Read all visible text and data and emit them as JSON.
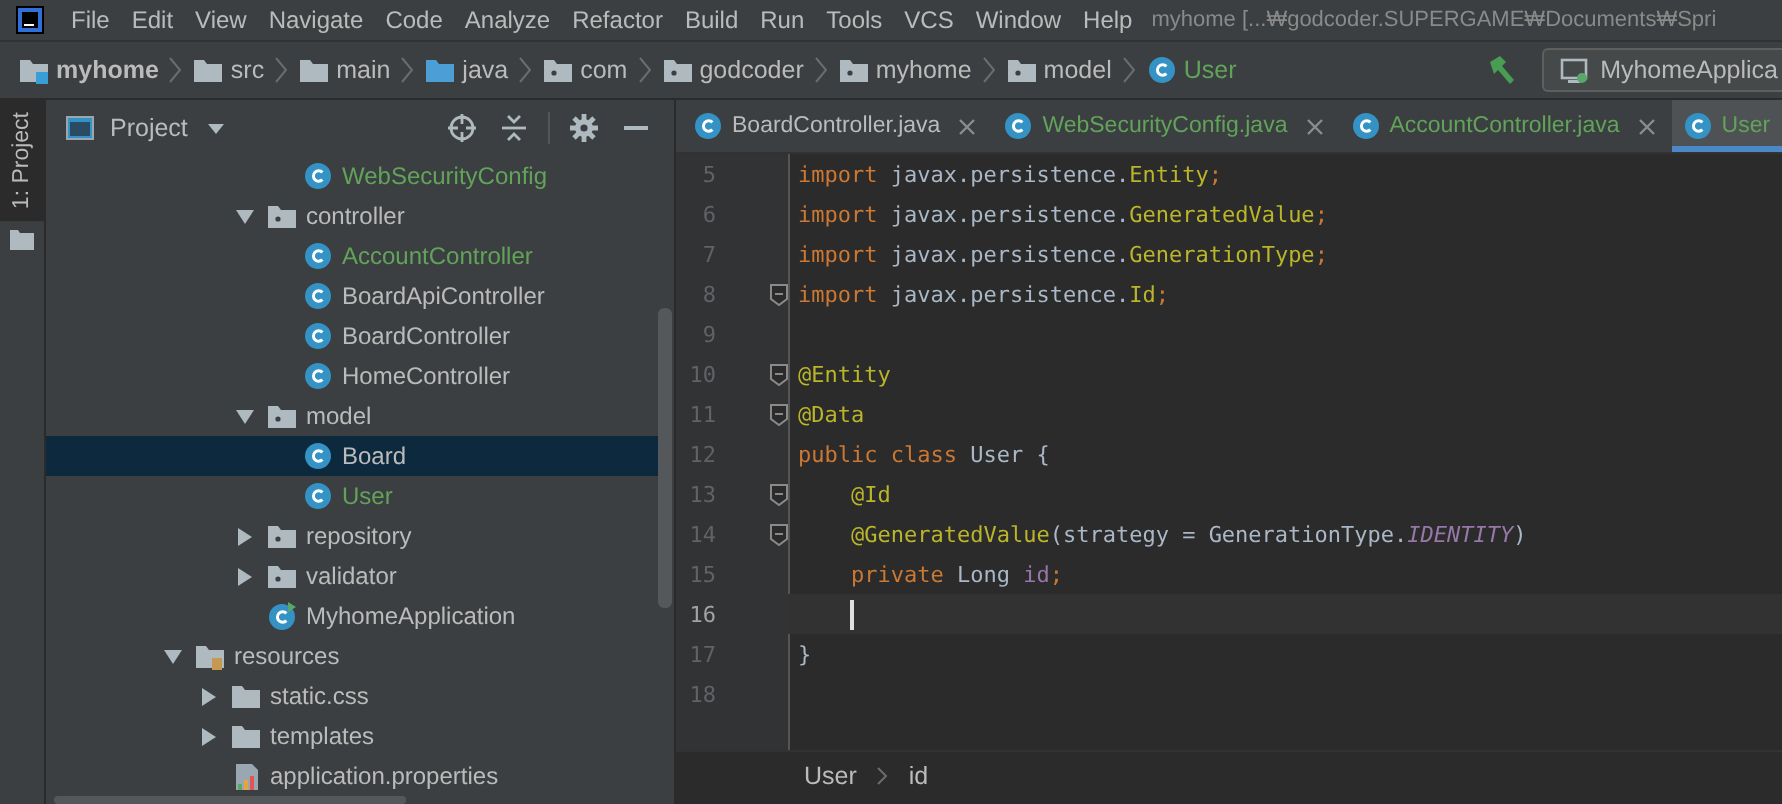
{
  "menu": [
    "File",
    "Edit",
    "View",
    "Navigate",
    "Code",
    "Analyze",
    "Refactor",
    "Build",
    "Run",
    "Tools",
    "VCS",
    "Window",
    "Help"
  ],
  "window": {
    "title": "myhome [...₩godcoder.SUPERGAME₩Documents₩Spri"
  },
  "breadcrumbs": [
    {
      "label": "myhome",
      "kind": "module",
      "color": "#bbbbbb"
    },
    {
      "label": "src",
      "kind": "folder",
      "color": "#bbbbbb"
    },
    {
      "label": "main",
      "kind": "folder",
      "color": "#bbbbbb"
    },
    {
      "label": "java",
      "kind": "source",
      "color": "#bbbbbb"
    },
    {
      "label": "com",
      "kind": "package",
      "color": "#bbbbbb"
    },
    {
      "label": "godcoder",
      "kind": "package",
      "color": "#bbbbbb"
    },
    {
      "label": "myhome",
      "kind": "package",
      "color": "#bbbbbb"
    },
    {
      "label": "model",
      "kind": "package",
      "color": "#bbbbbb"
    },
    {
      "label": "User",
      "kind": "class",
      "color": "#62a35a"
    }
  ],
  "run_config": {
    "label": "MyhomeApplica"
  },
  "side_tab": {
    "label": "1: Project"
  },
  "project_panel": {
    "title": "Project"
  },
  "tree": [
    {
      "children": [
        {
          "children": [
            {
              "children": [
                {
                  "label": "WebSecurityConfig",
                  "kind": "class",
                  "color": "#62a35a",
                  "selected": false
                }
              ]
            },
            {
              "label": "controller",
              "kind": "package",
              "expanded": true,
              "selected": false,
              "color": "#bbbbbb",
              "children": [
                {
                  "label": "AccountController",
                  "kind": "class",
                  "color": "#62a35a",
                  "selected": false
                },
                {
                  "label": "BoardApiController",
                  "kind": "class",
                  "color": "#bbbbbb",
                  "selected": false
                },
                {
                  "label": "BoardController",
                  "kind": "class",
                  "color": "#bbbbbb",
                  "selected": false
                },
                {
                  "label": "HomeController",
                  "kind": "class",
                  "color": "#bbbbbb",
                  "selected": false
                }
              ]
            },
            {
              "label": "model",
              "kind": "package",
              "expanded": true,
              "selected": false,
              "color": "#bbbbbb",
              "children": [
                {
                  "label": "Board",
                  "kind": "class",
                  "color": "#bbbbbb",
                  "selected": true
                },
                {
                  "label": "User",
                  "kind": "class",
                  "color": "#62a35a",
                  "selected": false
                }
              ]
            },
            {
              "label": "repository",
              "kind": "package",
              "expanded": false,
              "selected": false,
              "color": "#bbbbbb"
            },
            {
              "label": "validator",
              "kind": "package",
              "expanded": false,
              "selected": false,
              "color": "#bbbbbb"
            },
            {
              "label": "MyhomeApplication",
              "kind": "app",
              "color": "#bbbbbb",
              "selected": false
            }
          ]
        }
      ]
    },
    {
      "label": "resources",
      "kind": "resources",
      "expanded": true,
      "selected": false,
      "color": "#bbbbbb",
      "children": [
        {
          "label": "static.css",
          "kind": "folder",
          "expanded": false,
          "selected": false,
          "color": "#bbbbbb"
        },
        {
          "label": "templates",
          "kind": "folder",
          "expanded": false,
          "selected": false,
          "color": "#bbbbbb"
        },
        {
          "label": "application.properties",
          "kind": "properties",
          "color": "#bbbbbb",
          "selected": false
        }
      ]
    }
  ],
  "tabs": [
    {
      "label": "BoardController.java",
      "color": "#bbbbbb",
      "selected": false,
      "closable": true
    },
    {
      "label": "WebSecurityConfig.java",
      "color": "#62a35a",
      "selected": false,
      "closable": true
    },
    {
      "label": "AccountController.java",
      "color": "#62a35a",
      "selected": false,
      "closable": true
    },
    {
      "label": "User",
      "color": "#62a35a",
      "selected": true,
      "closable": false
    }
  ],
  "code": [
    {
      "number": "5",
      "fold": false,
      "current": false,
      "tokens": [
        {
          "text": "import",
          "kind": "keyword"
        },
        {
          "text": " javax.persistence.",
          "kind": "plain"
        },
        {
          "text": "Entity",
          "kind": "annotation"
        },
        {
          "text": ";",
          "kind": "keyword"
        }
      ]
    },
    {
      "number": "6",
      "fold": false,
      "current": false,
      "tokens": [
        {
          "text": "import",
          "kind": "keyword"
        },
        {
          "text": " javax.persistence.",
          "kind": "plain"
        },
        {
          "text": "GeneratedValue",
          "kind": "annotation"
        },
        {
          "text": ";",
          "kind": "keyword"
        }
      ]
    },
    {
      "number": "7",
      "fold": false,
      "current": false,
      "tokens": [
        {
          "text": "import",
          "kind": "keyword"
        },
        {
          "text": " javax.persistence.",
          "kind": "plain"
        },
        {
          "text": "GenerationType",
          "kind": "annotation"
        },
        {
          "text": ";",
          "kind": "keyword"
        }
      ]
    },
    {
      "number": "8",
      "fold": true,
      "current": false,
      "tokens": [
        {
          "text": "import",
          "kind": "keyword"
        },
        {
          "text": " javax.persistence.",
          "kind": "plain"
        },
        {
          "text": "Id",
          "kind": "annotation"
        },
        {
          "text": ";",
          "kind": "keyword"
        }
      ]
    },
    {
      "number": "9",
      "fold": false,
      "current": false
    },
    {
      "number": "10",
      "fold": true,
      "current": false,
      "tokens": [
        {
          "text": "@Entity",
          "kind": "annotation"
        }
      ]
    },
    {
      "number": "11",
      "fold": true,
      "current": false,
      "tokens": [
        {
          "text": "@Data",
          "kind": "annotation"
        }
      ]
    },
    {
      "number": "12",
      "fold": false,
      "current": false,
      "tokens": [
        {
          "text": "public class",
          "kind": "keyword"
        },
        {
          "text": " User {",
          "kind": "plain"
        }
      ]
    },
    {
      "number": "13",
      "fold": true,
      "current": false,
      "tokens": [
        {
          "text": "    @Id",
          "kind": "annotation"
        }
      ]
    },
    {
      "number": "14",
      "fold": true,
      "current": false,
      "tokens": [
        {
          "text": "    @GeneratedValue",
          "kind": "annotation"
        },
        {
          "text": "(strategy = GenerationType.",
          "kind": "plain"
        },
        {
          "text": "IDENTITY",
          "kind": "constant"
        },
        {
          "text": ")",
          "kind": "plain"
        }
      ]
    },
    {
      "number": "15",
      "fold": false,
      "current": false,
      "tokens": [
        {
          "text": "    private",
          "kind": "keyword"
        },
        {
          "text": " Long ",
          "kind": "plain"
        },
        {
          "text": "id",
          "kind": "field"
        },
        {
          "text": ";",
          "kind": "keyword"
        }
      ]
    },
    {
      "number": "16",
      "fold": false,
      "current": true
    },
    {
      "number": "17",
      "fold": false,
      "current": false,
      "tokens": [
        {
          "text": "}",
          "kind": "plain"
        }
      ]
    },
    {
      "number": "18",
      "fold": false,
      "current": false
    }
  ],
  "editor_breadcrumbs": [
    "User",
    "id"
  ]
}
